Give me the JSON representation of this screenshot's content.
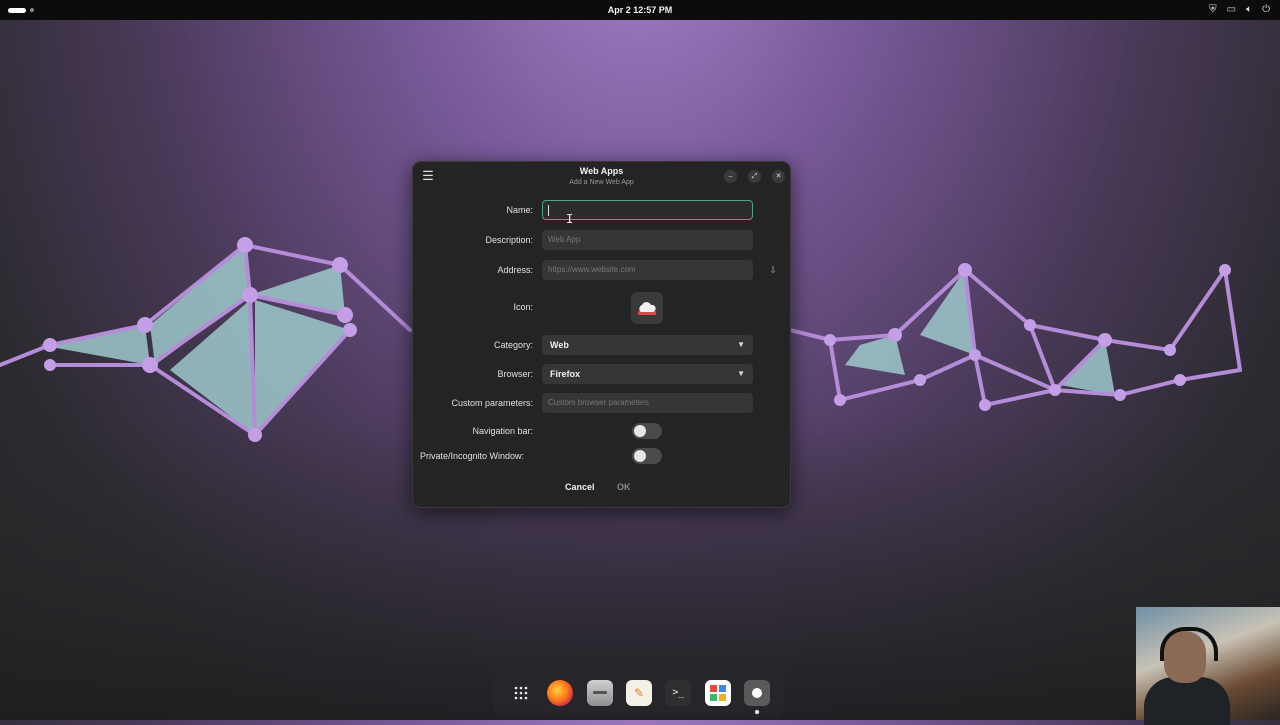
{
  "topbar": {
    "clock": "Apr 2  12:57 PM",
    "tray_icons": [
      "shield-icon",
      "screen-icon",
      "volume-icon",
      "power-icon"
    ]
  },
  "window": {
    "title": "Web Apps",
    "subtitle": "Add a New Web App",
    "fields": {
      "name_label": "Name:",
      "name_value": "",
      "description_label": "Description:",
      "description_placeholder": "Web App",
      "address_label": "Address:",
      "address_placeholder": "https://www.website.com",
      "icon_label": "Icon:",
      "category_label": "Category:",
      "category_value": "Web",
      "browser_label": "Browser:",
      "browser_value": "Firefox",
      "custom_params_label": "Custom parameters:",
      "custom_params_placeholder": "Custom browser parameters",
      "navbar_label": "Navigation bar:",
      "navbar_enabled": false,
      "private_label": "Private/Incognito Window:",
      "private_enabled": false
    },
    "buttons": {
      "cancel": "Cancel",
      "ok": "OK"
    }
  },
  "dock": {
    "items": [
      "app-grid-icon",
      "firefox-icon",
      "files-icon",
      "text-editor-icon",
      "terminal-icon",
      "software-center-icon",
      "web-apps-icon"
    ]
  },
  "colors": {
    "accent": "#4ca58b",
    "window_bg": "#242424",
    "entry_bg": "#363636"
  }
}
